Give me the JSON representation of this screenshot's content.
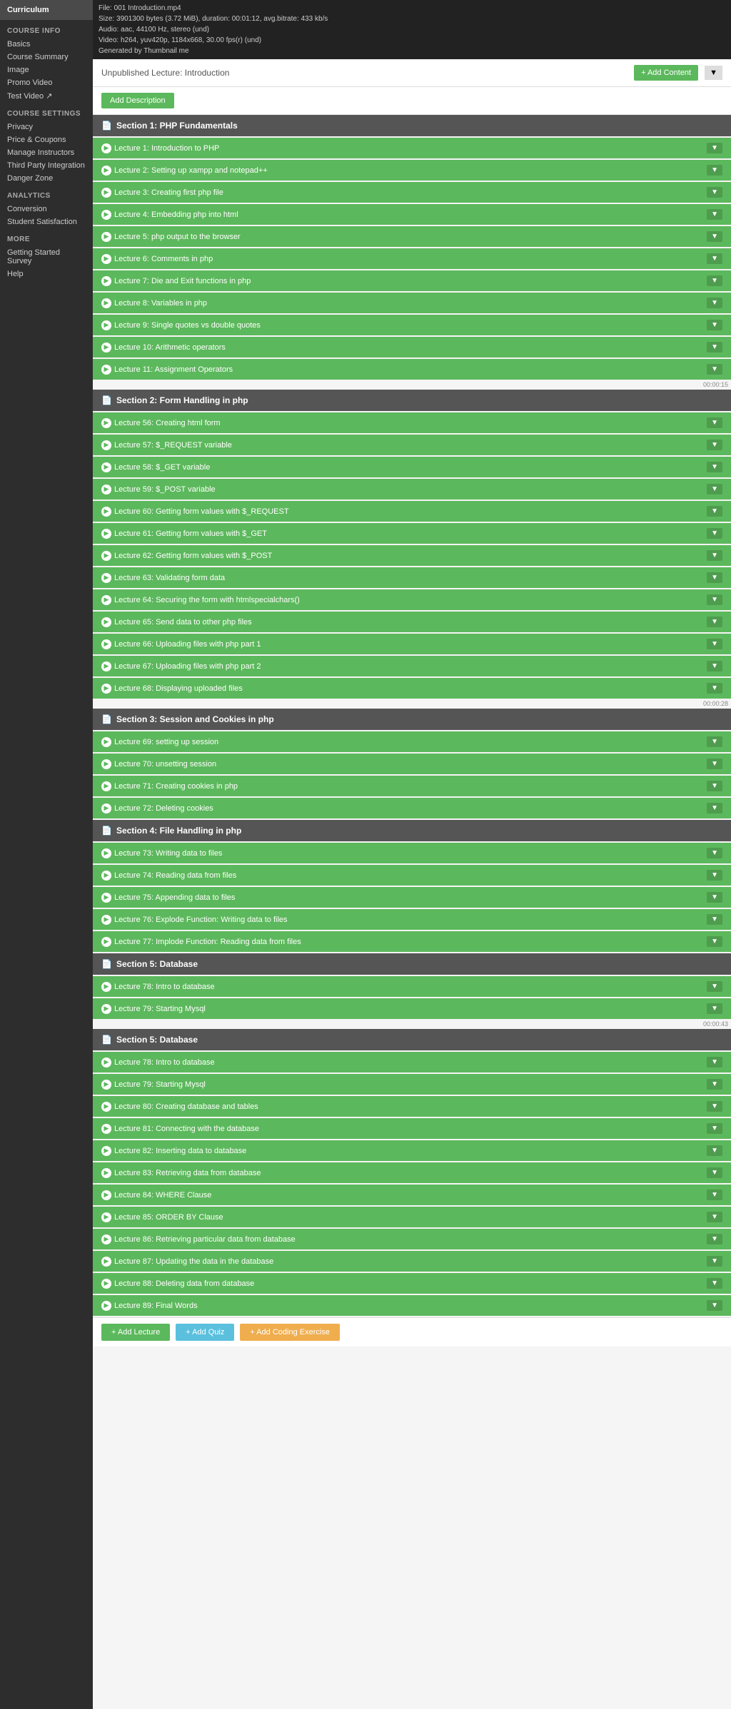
{
  "videoInfo": [
    "File: 001 Introduction.mp4",
    "Size: 3901300 bytes (3.72 MiB), duration: 00:01:12, avg.bitrate: 433 kb/s",
    "Audio: aac, 44100 Hz, stereo (und)",
    "Video: h264, yuv420p, 1184x668, 30.00 fps(r) (und)",
    "Generated by Thumbnail me"
  ],
  "sidebar": {
    "curriculumTab": "Curriculum",
    "courseInfoLabel": "COURSE INFO",
    "courseInfoLinks": [
      "Basics",
      "Course Summary",
      "Image",
      "Promo Video",
      "Test Video ↗"
    ],
    "courseSettingsLabel": "COURSE SETTINGS",
    "courseSettingsLinks": [
      "Privacy",
      "Price & Coupons",
      "Manage Instructors",
      "Third Party Integration",
      "Danger Zone"
    ],
    "analyticsLabel": "ANALYTICS",
    "analyticsLinks": [
      "Conversion",
      "Student Satisfaction"
    ],
    "moreLabel": "MORE",
    "moreLinks": [
      "Getting Started Survey",
      "Help"
    ]
  },
  "header": {
    "unpublishedLabel": "Unpublished Lecture: Introduction",
    "addContentBtn": "+ Add Content",
    "addDescriptionBtn": "Add Description"
  },
  "sections": [
    {
      "id": "s1",
      "title": "Section 1: PHP Fundamentals",
      "lectures": [
        "Lecture 1: Introduction to PHP",
        "Lecture 2: Setting up xampp and notepad++",
        "Lecture 3: Creating first php file",
        "Lecture 4: Embedding php into html",
        "Lecture 5: php output to the browser",
        "Lecture 6: Comments in php",
        "Lecture 7: Die and Exit functions in php",
        "Lecture 8: Variables in php",
        "Lecture 9: Single quotes vs double quotes",
        "Lecture 10: Arithmetic operators",
        "Lecture 11: Assignment Operators"
      ],
      "timer": "00:00:15"
    },
    {
      "id": "s2",
      "title": "Section 2: Form Handling in php",
      "lectures": [
        "Lecture 56: Creating html form",
        "Lecture 57: $_REQUEST variable",
        "Lecture 58: $_GET variable",
        "Lecture 59: $_POST variable",
        "Lecture 60: Getting form values with $_REQUEST",
        "Lecture 61: Getting form values with $_GET",
        "Lecture 62: Getting form values with $_POST",
        "Lecture 63: Validating form data",
        "Lecture 64: Securing the form with htmlspecialchars()",
        "Lecture 65: Send data to other php files",
        "Lecture 66: Uploading files with php part 1",
        "Lecture 67: Uploading files with php part 2",
        "Lecture 68: Displaying uploaded files"
      ],
      "timer": "00:00:28"
    },
    {
      "id": "s3",
      "title": "Section 3: Session and Cookies in php",
      "lectures": [
        "Lecture 69: setting up session",
        "Lecture 70: unsetting session",
        "Lecture 71: Creating cookies in php",
        "Lecture 72: Deleting cookies"
      ],
      "timer": ""
    },
    {
      "id": "s4",
      "title": "Section 4: File Handling in php",
      "lectures": [
        "Lecture 73: Writing data to files",
        "Lecture 74: Reading data from files",
        "Lecture 75: Appending data to files",
        "Lecture 76: Explode Function: Writing data to files",
        "Lecture 77: Implode Function: Reading data from files"
      ],
      "timer": ""
    },
    {
      "id": "s5a",
      "title": "Section 5: Database",
      "lectures": [
        "Lecture 78: Intro to database",
        "Lecture 79: Starting Mysql"
      ],
      "timer": "00:00:43"
    },
    {
      "id": "s5b",
      "title": "Section 5: Database",
      "lectures": [
        "Lecture 78: Intro to database",
        "Lecture 79: Starting Mysql",
        "Lecture 80: Creating database and tables",
        "Lecture 81: Connecting with the database",
        "Lecture 82: Inserting data to database",
        "Lecture 83: Retrieving data from database",
        "Lecture 84: WHERE Clause",
        "Lecture 85: ORDER BY Clause",
        "Lecture 86: Retrieving particular data from database",
        "Lecture 87: Updating the data in the database",
        "Lecture 88: Deleting data from database",
        "Lecture 89: Final Words"
      ],
      "timer": ""
    }
  ],
  "bottomBar": {
    "addLectureBtn": "+ Add Lecture",
    "addQuizBtn": "+ Add Quiz",
    "addCodingExerciseBtn": "+ Add Coding Exercise"
  }
}
